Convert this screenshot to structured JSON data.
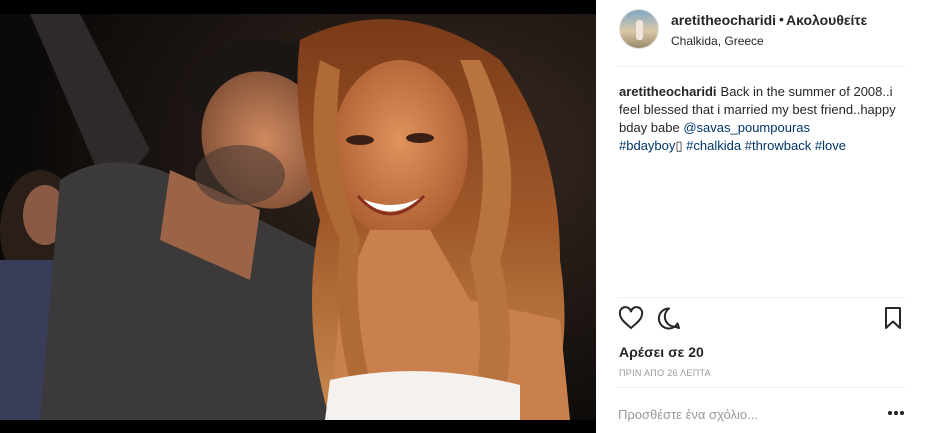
{
  "post": {
    "photo_alt": "Couple selfie at night",
    "username": "aretitheocharidi",
    "separator": "•",
    "follow_label": "Ακολουθείτε",
    "location": "Chalkida, Greece"
  },
  "caption": {
    "username": "aretitheocharidi",
    "text_part1": "Back in the summer of 2008..i feel blessed that i married my best friend..happy bday babe",
    "mention": "@savas_poumpouras",
    "hashtags": [
      "#bdayboy",
      "#chalkida",
      "#throwback",
      "#love"
    ],
    "emoji_placeholder": "▯"
  },
  "actions": {
    "like_icon": "heart-icon",
    "comment_icon": "comment-icon",
    "save_icon": "bookmark-icon"
  },
  "likes_text": "Αρέσει σε 20",
  "time_text": "ΠΡΙΝ ΑΠΟ 26 ΛΕΠΤΑ",
  "comment": {
    "placeholder": "Προσθέστε ένα σχόλιο...",
    "more_icon": "more-options-icon"
  },
  "colors": {
    "link": "#003569",
    "text": "#262626",
    "muted": "#999999",
    "divider": "#efefef"
  }
}
